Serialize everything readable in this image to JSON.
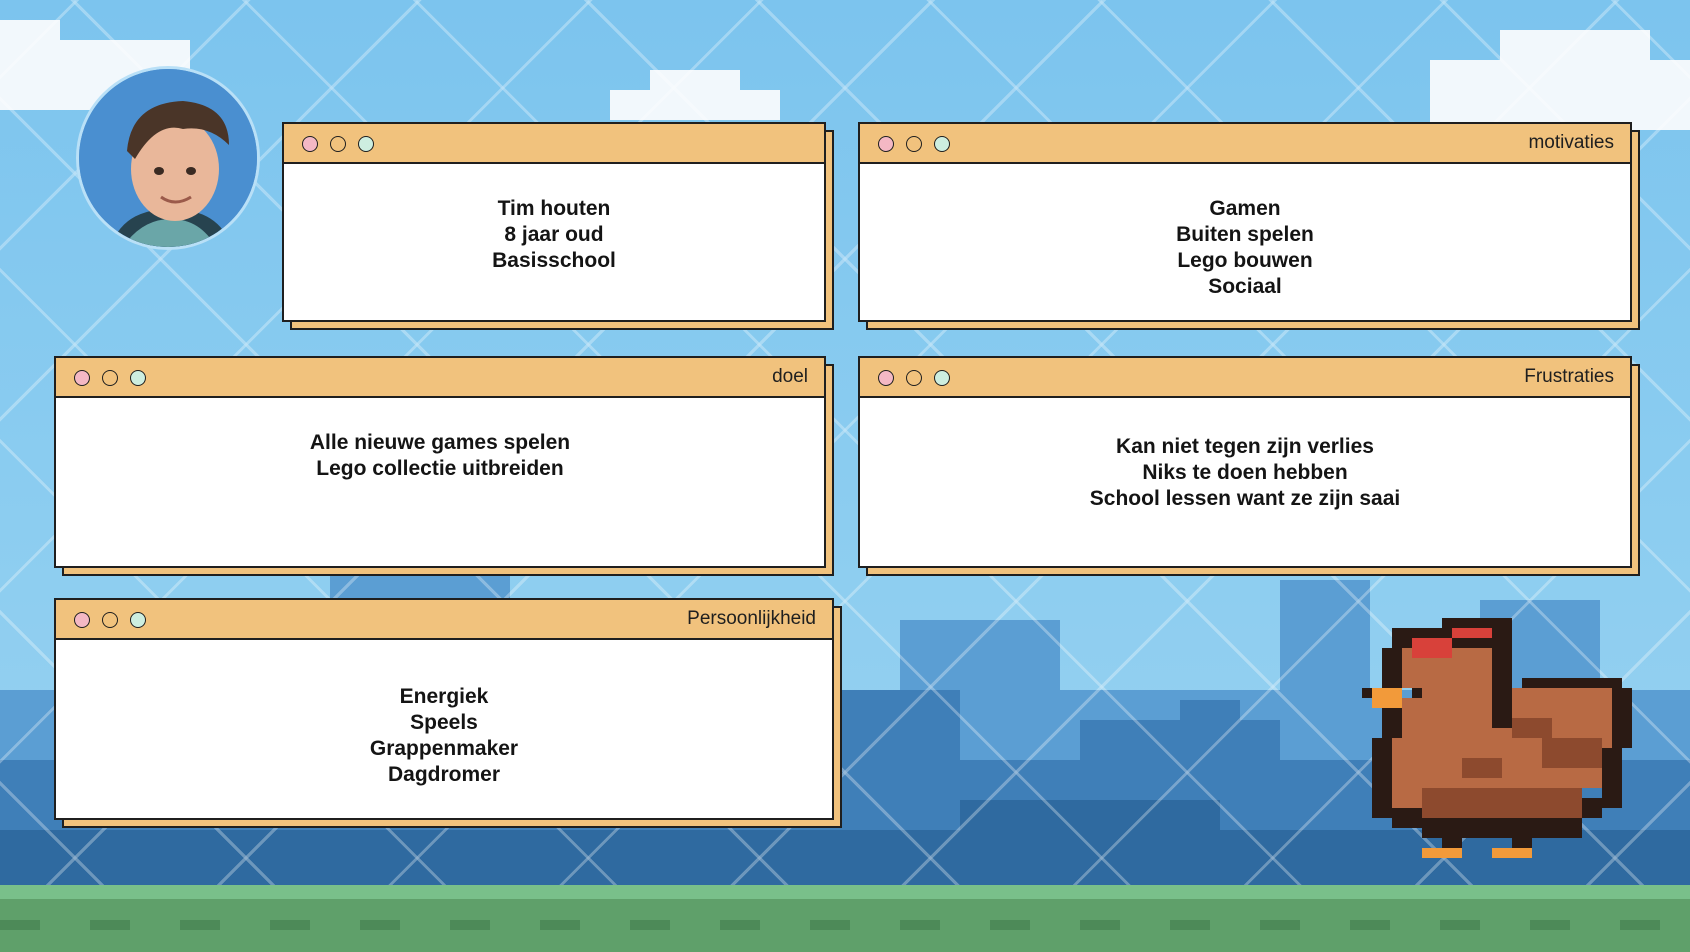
{
  "profile": {
    "lines": [
      "Tim houten",
      "8 jaar oud",
      "Basisschool"
    ]
  },
  "motivaties": {
    "title": "motivaties",
    "lines": [
      "Gamen",
      "Buiten spelen",
      "Lego bouwen",
      "Sociaal"
    ]
  },
  "doel": {
    "title": "doel",
    "lines": [
      "Alle nieuwe games spelen",
      "Lego collectie uitbreiden"
    ]
  },
  "frustraties": {
    "title": "Frustraties",
    "lines": [
      "Kan niet tegen zijn verlies",
      "Niks te doen hebben",
      "School lessen want ze zijn saai"
    ]
  },
  "persoonlijkheid": {
    "title": "Persoonlijkheid",
    "lines": [
      "Energiek",
      "Speels",
      "Grappenmaker",
      "Dagdromer"
    ]
  },
  "colors": {
    "window_bar": "#f1c27d",
    "dot_red": "#f4b8c4",
    "dot_green": "#cdeee0",
    "sky": "#86c9ee",
    "ground": "#5fa06a"
  },
  "icons": [
    "avatar-photo",
    "pixel-chicken",
    "window-dots"
  ]
}
